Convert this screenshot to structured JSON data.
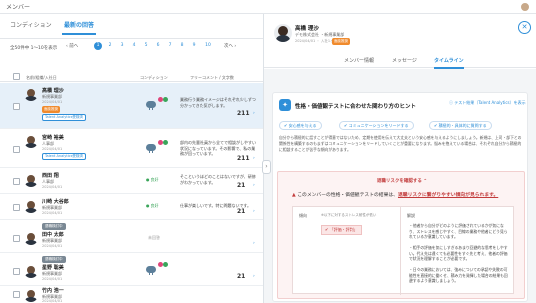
{
  "topbar": {
    "title": "メンバー"
  },
  "left": {
    "tabs": [
      "コンディション",
      "最新の回答"
    ],
    "count": "全50件中 1〜10を表示",
    "pager": {
      "prev": "‹ 前へ",
      "pages": [
        "1",
        "2",
        "3",
        "4",
        "5",
        "6",
        "7",
        "8",
        "9",
        "10"
      ],
      "current": "1",
      "next": "次へ ›"
    },
    "columns": [
      "名前/組織/入社日",
      "コンディション",
      "フリーコメント / 文字数"
    ],
    "rows": [
      {
        "name": "高橋 理沙",
        "sub": "新規事業部",
        "date": "2024/04/01",
        "tag_orange": "面談推奨",
        "tag_link": "Talent Analytics受検済",
        "free": "業務行う業務イメージはそれぞれ少しずつ分かってきた気がします。",
        "num": "211",
        "more": "›",
        "icon_colors": [
          "#e0457a",
          "#3aa55a"
        ]
      },
      {
        "name": "宮崎 裕美",
        "sub": "人事部",
        "date": "2024/04/01",
        "tag_link": "Talent Analytics受検済",
        "free": "部内の先輩社員から全てで相談がしやすい状況になっています。その影響で、私の業務が回っています。",
        "num": "211",
        "more": "›",
        "icon_colors": [
          "#e0457a",
          "#3aa55a"
        ]
      },
      {
        "name": "西田 翔",
        "sub": "人事部",
        "date": "2024/04/01",
        "good": "良好",
        "free": "そこというほどのことはないですが、研修がわかっています。",
        "num": "21",
        "more": "›"
      },
      {
        "name": "川崎 大谷郎",
        "sub": "新規事業部",
        "date": "2024/04/01",
        "good": "良好",
        "free": "仕事が楽しいです。特に問題ないです。",
        "num": "21",
        "more": "›"
      },
      {
        "name": "田中 太郎",
        "sub": "新規事業部",
        "date": "2024/04/01",
        "badge": "退職検討中",
        "cond_text": "未回答",
        "free": "",
        "num": "",
        "more": "›"
      },
      {
        "name": "星野 聡美",
        "sub": "新規事業部",
        "date": "2024/04/01",
        "badge": "退職検討中",
        "free": "",
        "num": "21",
        "more": "›",
        "icon_colors": [
          "#e0457a",
          "#3aa55a"
        ]
      },
      {
        "name": "竹内 浩一",
        "sub": "新規事業部",
        "date": "2024/04/01",
        "free": "",
        "num": "",
        "more": "›"
      }
    ]
  },
  "right": {
    "profile": {
      "name": "高橋 理沙",
      "sub": "デモ株式会社 ・新規事業部",
      "meta": "2024/04/01 ・ 入社1ヶ月",
      "orange": "面談推奨"
    },
    "tabs": [
      "メンバー情報",
      "メッセージ",
      "タイムライン"
    ],
    "card": {
      "title": "性格・価値観テストに合わせた関わり方のヒント",
      "link": "ⓘ テスト結果（Talent Analytics）を表示",
      "chips": [
        "✔ 安心感を与える",
        "✔ コミュニケーションをリードする",
        "✔ 積極的・具体的に質問する"
      ],
      "para": "自分から積極的に話すことが得意ではないため、定期を使用を伝えて大丈夫という安心感を与えるようにしましょう。新規は、上司・部下との関係性を構築するのもまずはコミュニケーションをリードしていくことが重要になります。悩みを抱えている場合は、それぞれ自分から積極的に相談することが苦手な傾向があります。",
      "alert": {
        "head": "退職リスクを確認する ⌃",
        "msg_pre": "このメンバーの性格・価値観テストの結果は、",
        "msg_hl": "退職リスクに繋がりやすい傾向が見られます。",
        "col1": "傾向",
        "col1_sub": "※以下に対するストレス耐性が低い",
        "tag": "「評価・評判」",
        "col2": "解説",
        "bullets": [
          "・他者から自分がどのように評価されているかが気になり、ストレスを感じやすく、目線の業務や他者にどう見られているか意識しています。",
          "・相手の評価を気にしすぎるあまり回避的な思考をしやすい。代え先は遠くても必要性をすぐ先と考え、他者の評価で状況を理解することが必要です。",
          "・日々の業務においては、強みについての承認や失敗の可能性を直接的に働くせ、積み力を発揮した場合の結果も回避するよう意識しましょう。"
        ]
      }
    }
  }
}
